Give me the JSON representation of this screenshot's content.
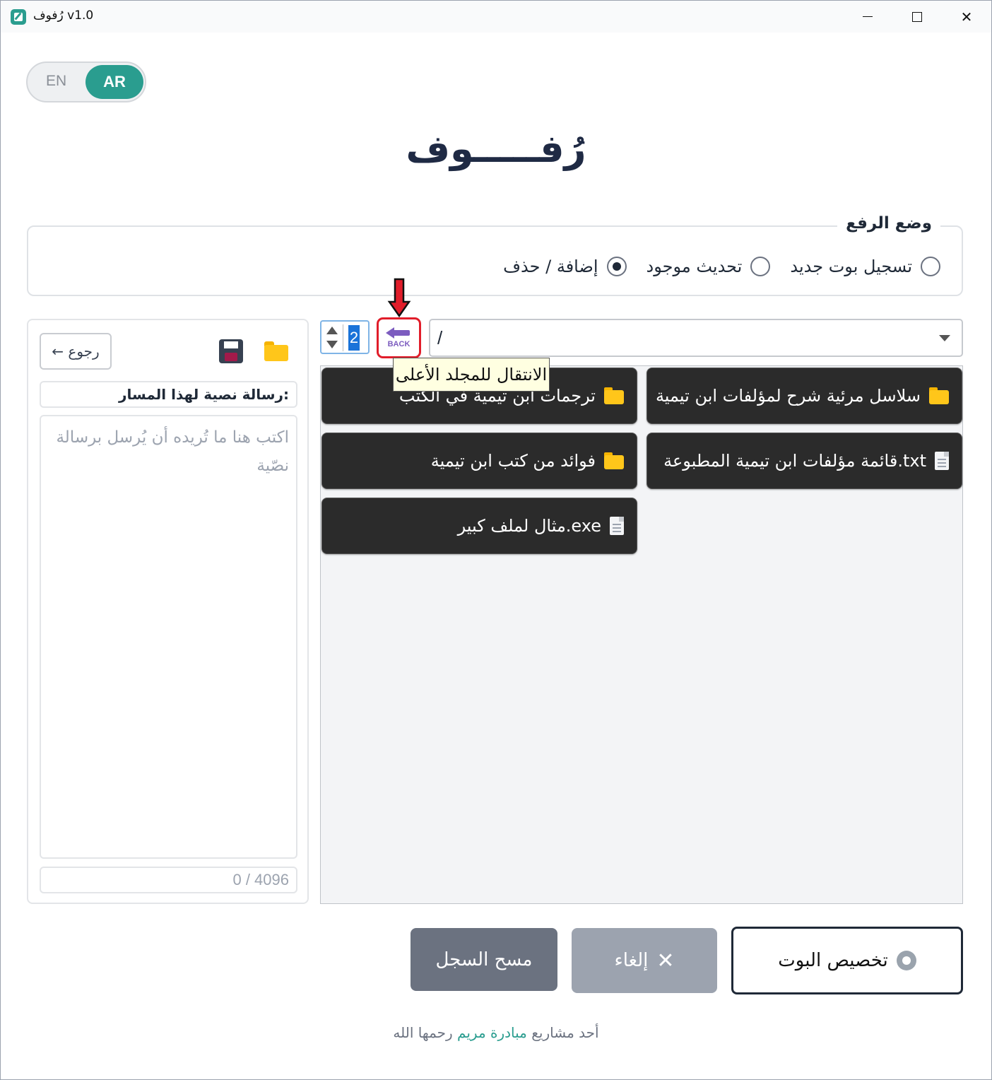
{
  "window": {
    "title": "رُفوف v1.0",
    "icon": "app-edit-icon"
  },
  "lang_toggle": {
    "en": "EN",
    "ar": "AR",
    "selected": "AR"
  },
  "logo": "رُفـــــوف",
  "upload_mode": {
    "legend": "وضع الرفع",
    "options": [
      "تسجيل بوت جديد",
      "تحديث موجود",
      "إضافة / حذف"
    ],
    "selected": "إضافة / حذف"
  },
  "side_panel": {
    "back_label": "← رجوع",
    "message_label": "رسالة نصية لهذا المسار:",
    "message_placeholder": "اكتب هنا ما تُريده أن يُرسل برسالة نصّية",
    "counter": "0 / 4096"
  },
  "toolbar": {
    "columns_value": "2",
    "up_button_text": "BACK",
    "path": "/",
    "tooltip": "الانتقال للمجلد الأعلى"
  },
  "items": [
    {
      "label": "سلاسل مرئية شرح لمؤلفات ابن تيمية",
      "type": "folder"
    },
    {
      "label": "ترجمات ابن تيمية في الكتب",
      "type": "folder"
    },
    {
      "label": "قائمة مؤلفات ابن تيمية المطبوعة.txt",
      "type": "file"
    },
    {
      "label": "فوائد من كتب ابن تيمية",
      "type": "folder"
    },
    {
      "label": "مثال لملف كبير.exe",
      "type": "file"
    }
  ],
  "buttons": {
    "clear_log": "مسح السجل",
    "cancel": "إلغاء",
    "customize": "تخصيص البوت"
  },
  "footer": {
    "prefix": "أحد مشاريع",
    "link": "مبادرة مريم",
    "suffix": "رحمها الله"
  },
  "colors": {
    "accent": "#2a9d8f",
    "item_bg": "#2b2b2b",
    "highlight": "#e11d2a",
    "up_icon": "#7c5cbf"
  }
}
